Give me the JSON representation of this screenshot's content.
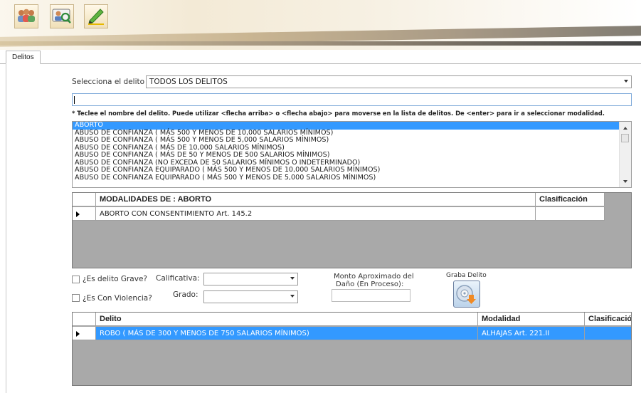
{
  "toolbar": {
    "buttons": [
      {
        "icon": "users-group-icon"
      },
      {
        "icon": "person-search-icon"
      },
      {
        "icon": "pen-edit-icon"
      }
    ]
  },
  "tabs": [
    {
      "label": "Delitos",
      "active": true
    }
  ],
  "form": {
    "delito_label": "Selecciona el delito",
    "delito_value": "TODOS LOS DELITOS",
    "search_value": "",
    "hint": "* Teclee el nombre del delito. Puede utilizar <flecha arriba> o <flecha abajo> para moverse en la lista de delitos. De <enter> para ir a seleccionar modalidad.",
    "delitos_list": [
      "ABORTO",
      "ABUSO DE CONFIANZA ( MÁS 500 Y MENOS DE 10,000 SALARIOS MÍNIMOS)",
      "ABUSO DE CONFIANZA ( MÁS 500 Y MENOS DE 5,000 SALARIOS MÍNIMOS)",
      "ABUSO DE CONFIANZA ( MÁS DE 10,000 SALARIOS MÍNIMOS)",
      "ABUSO DE CONFIANZA ( MÁS DE 50 Y MENOS DE 500 SALARIOS MÍNIMOS)",
      "ABUSO DE CONFIANZA (NO EXCEDA DE 50 SALARIOS MÍNIMOS O INDETERMINADO)",
      "ABUSO DE CONFIANZA EQUIPARADO ( MÁS 500 Y MENOS DE 10,000 SALARIOS MÍNIMOS)",
      "ABUSO DE CONFIANZA EQUIPARADO ( MÁS 500 Y MENOS DE 5,000 SALARIOS MÍNIMOS)"
    ],
    "selected_index": 0
  },
  "modalidades_grid": {
    "headers": {
      "modalidad": "MODALIDADES DE : ABORTO",
      "clasificacion": "Clasificación"
    },
    "rows": [
      {
        "modalidad": "ABORTO CON CONSENTIMIENTO Art. 145.2",
        "clasificacion": ""
      }
    ]
  },
  "options": {
    "grave_label": "¿Es delito Grave?",
    "grave_checked": false,
    "violencia_label": "¿Es Con Violencia?",
    "violencia_checked": false,
    "calificativa_label": "Calificativa:",
    "calificativa_value": "",
    "grado_label": "Grado:",
    "grado_value": "",
    "monto_label_line1": "Monto Aproximado del",
    "monto_label_line2": "Daño (En Proceso):",
    "monto_value": "",
    "save_label": "Graba Delito",
    "save_icon": "save-record-icon"
  },
  "delitos_grid": {
    "headers": {
      "delito": "Delito",
      "modalidad": "Modalidad",
      "clasificacion": "Clasificación"
    },
    "rows": [
      {
        "delito": "ROBO ( MÁS DE 300 Y MENOS DE 750 SALARIOS MÍNIMOS)",
        "modalidad": "ALHAJAS Art. 221.II",
        "clasificacion": ""
      }
    ]
  },
  "colors": {
    "selection": "#3399ff",
    "grid_bg": "#a9a9a9",
    "accent_border": "#7aa7d8"
  }
}
